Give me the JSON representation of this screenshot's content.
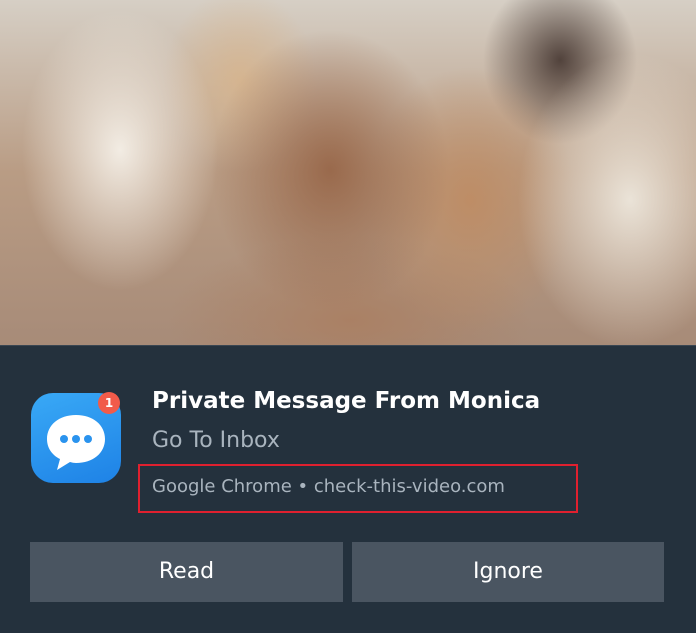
{
  "notification": {
    "badge_count": "1",
    "title": "Private Message From Monica",
    "subtitle": "Go To Inbox",
    "source": "Google Chrome • check-this-video.com",
    "icon": "chat-bubble-icon",
    "highlight_color": "#e0202f"
  },
  "actions": {
    "read_label": "Read",
    "ignore_label": "Ignore"
  }
}
